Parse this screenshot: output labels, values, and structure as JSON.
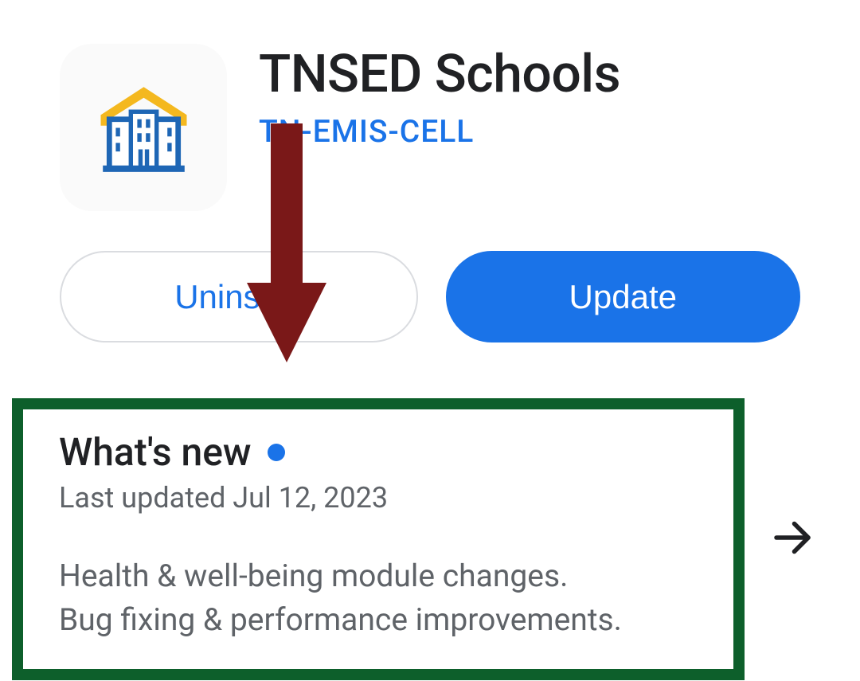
{
  "app": {
    "title": "TNSED Schools",
    "developer": "TN-EMIS-CELL"
  },
  "buttons": {
    "uninstall": "Uninstall",
    "update": "Update"
  },
  "whatsNew": {
    "title": "What's new",
    "lastUpdated": "Last updated Jul 12, 2023",
    "line1": "Health & well-being module changes.",
    "line2": "Bug fixing & performance improvements."
  }
}
